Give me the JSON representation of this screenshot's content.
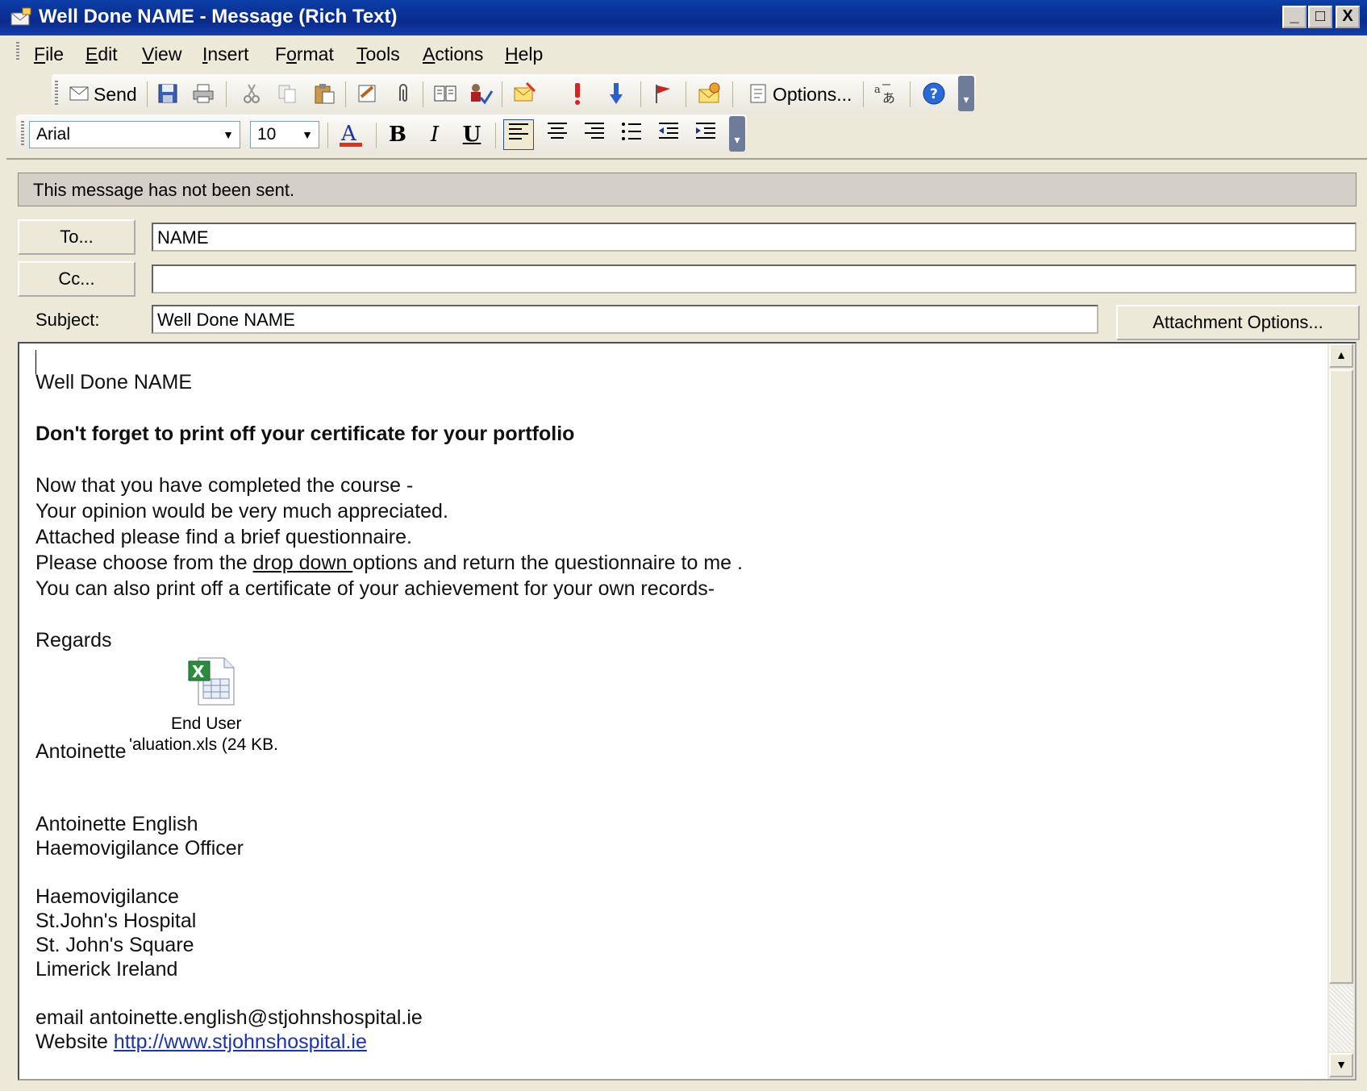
{
  "window": {
    "title": "Well Done NAME - Message (Rich Text)",
    "controls": {
      "minimize": "_",
      "maximize": "□",
      "close": "X"
    }
  },
  "menu": {
    "items": [
      {
        "key": "file",
        "pre": "",
        "acc": "F",
        "post": "ile"
      },
      {
        "key": "edit",
        "pre": "",
        "acc": "E",
        "post": "dit"
      },
      {
        "key": "view",
        "pre": "",
        "acc": "V",
        "post": "iew"
      },
      {
        "key": "insert",
        "pre": "",
        "acc": "I",
        "post": "nsert"
      },
      {
        "key": "format",
        "pre": "F",
        "acc": "o",
        "post": "rmat"
      },
      {
        "key": "tools",
        "pre": "",
        "acc": "T",
        "post": "ools"
      },
      {
        "key": "actions",
        "pre": "",
        "acc": "A",
        "post": "ctions"
      },
      {
        "key": "help",
        "pre": "",
        "acc": "H",
        "post": "elp"
      }
    ]
  },
  "toolbar": {
    "send_label": "Send",
    "options_label": "Options...",
    "font_name": "Arial",
    "font_size": "10",
    "bold": "B",
    "italic": "I",
    "underline": "U"
  },
  "info_bar": {
    "text": "This message has not been sent."
  },
  "addressing": {
    "to_button": "To...",
    "cc_button": "Cc...",
    "subject_label": "Subject:",
    "to_value": "NAME",
    "cc_value": "",
    "subject_value": "Well Done NAME",
    "attachment_options": "Attachment Options..."
  },
  "body": {
    "greeting": "Well Done  NAME",
    "reminder": "Don't forget to print off your certificate for your portfolio",
    "p1": "Now that you have completed the course -",
    "p2": "Your opinion would be very much appreciated.",
    "p3": "Attached please find a brief questionnaire.",
    "p4_pre": "Please choose from the ",
    "p4_link": "drop down ",
    "p4_post": " options and return the questionnaire to me .",
    "p5": "You can also print off a certificate of your achievement for your own records-",
    "regards": "Regards",
    "sign_first": "Antoinette",
    "attachment_line1": "End User",
    "attachment_line2": "'aluation.xls (24 KB.",
    "sig_name": "Antoinette English",
    "sig_title": "Haemovigilance Officer",
    "dept": "Haemovigilance",
    "hospital": "St.John's Hospital",
    "street": "St. John's Square",
    "city": "Limerick Ireland",
    "email_line": "email antoinette.english@stjohnshospital.ie",
    "website_label": "Website ",
    "website_url": "http://www.stjohnshospital.ie"
  },
  "colors": {
    "titlebar": "#0a2a8c",
    "link": "#1a33b0",
    "chrome": "#ece9d8"
  },
  "icons": [
    "envelope-icon",
    "send-icon",
    "save-icon",
    "print-icon",
    "cut-icon",
    "copy-icon",
    "paste-icon",
    "signature-icon",
    "paperclip-icon",
    "address-book-icon",
    "check-names-icon",
    "follow-up-icon",
    "high-importance-icon",
    "low-importance-icon",
    "flag-icon",
    "permission-icon",
    "options-icon",
    "spelling-icon",
    "help-icon",
    "font-color-icon",
    "excel-file-icon"
  ]
}
